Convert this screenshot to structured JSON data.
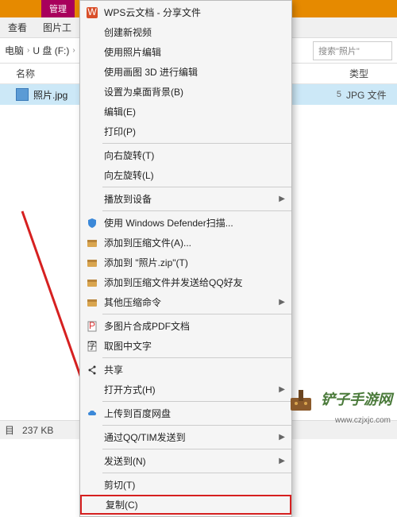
{
  "ribbon": {
    "tab": "管理"
  },
  "menubar": {
    "view": "查看",
    "tools": "图片工"
  },
  "breadcrumb": {
    "pc": "电脑",
    "drive": "U 盘 (F:)"
  },
  "search": {
    "placeholder": "搜索\"照片\""
  },
  "columns": {
    "name": "名称",
    "type": "类型"
  },
  "file": {
    "name": "照片.jpg",
    "date": "5",
    "type": "JPG 文件"
  },
  "status": {
    "count": "目",
    "size": "237 KB"
  },
  "ctx": {
    "items": [
      {
        "label": "WPS云文档 - 分享文件",
        "icon": "wps"
      },
      {
        "label": "创建新视频"
      },
      {
        "label": "使用照片编辑"
      },
      {
        "label": "使用画图 3D 进行编辑"
      },
      {
        "label": "设置为桌面背景(B)"
      },
      {
        "label": "编辑(E)"
      },
      {
        "label": "打印(P)"
      }
    ],
    "rotate_r": "向右旋转(T)",
    "rotate_l": "向左旋转(L)",
    "cast": "播放到设备",
    "defender": "使用 Windows Defender扫描...",
    "zip_add": "添加到压缩文件(A)...",
    "zip_photo": "添加到 \"照片.zip\"(T)",
    "zip_qq": "添加到压缩文件并发送给QQ好友",
    "zip_other": "其他压缩命令",
    "pdf": "多图片合成PDF文档",
    "ocr": "取图中文字",
    "share": "共享",
    "open_with": "打开方式(H)",
    "baidu": "上传到百度网盘",
    "qq_send": "通过QQ/TIM发送到",
    "send_to": "发送到(N)",
    "cut": "剪切(T)",
    "copy": "复制(C)"
  },
  "watermark": {
    "text": "铲子手游网",
    "url": "www.czjxjc.com"
  }
}
